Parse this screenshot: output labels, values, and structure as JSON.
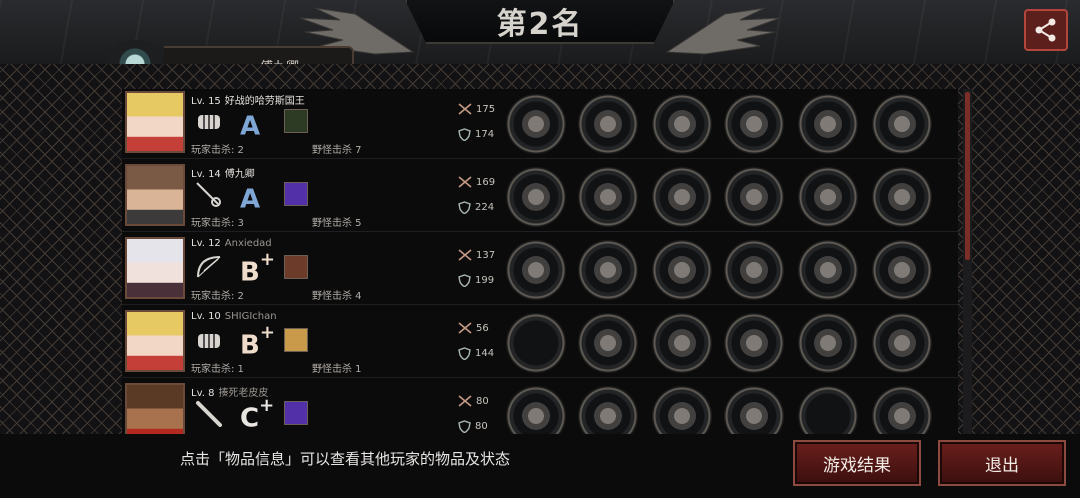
{
  "header": {
    "title": "第2名",
    "player_tab_label": "傅九卿"
  },
  "players": [
    {
      "level": "Lv. 15",
      "name": "好战的哈劳斯国王",
      "name_dim": false,
      "weapon": "fist",
      "rank": "A",
      "rank_sup": "",
      "rank_class": "a",
      "kills": "玩家击杀: 2",
      "monster_kills": "野怪击杀 7",
      "attack": "175",
      "defense": "174",
      "items": [
        "gauntlet",
        "helmet",
        "chainmail",
        "shield",
        "boots",
        "scope"
      ]
    },
    {
      "level": "Lv. 14",
      "name": "傅九卿",
      "name_dim": false,
      "weapon": "rapier",
      "rank": "A",
      "rank_sup": "",
      "rank_class": "a",
      "kills": "玩家击杀: 3",
      "monster_kills": "野怪击杀 5",
      "attack": "169",
      "defense": "224",
      "items": [
        "spear",
        "helmet-dark",
        "armor-dark",
        "gloves-white",
        "scroll",
        "galaxy"
      ]
    },
    {
      "level": "Lv. 12",
      "name": "Anxiedad",
      "name_dim": true,
      "weapon": "bow",
      "rank": "B",
      "rank_sup": "+",
      "rank_class": "b",
      "kills": "玩家击杀: 2",
      "monster_kills": "野怪击杀 4",
      "attack": "137",
      "defense": "199",
      "items": [
        "bow-pink",
        "helmet-gold",
        "armor-red",
        "necklace",
        "boots-purple",
        "bracer"
      ]
    },
    {
      "level": "Lv. 10",
      "name": "SHIGIchan",
      "name_dim": true,
      "weapon": "fist",
      "rank": "B",
      "rank_sup": "+",
      "rank_class": "b",
      "kills": "玩家击杀: 1",
      "monster_kills": "野怪击杀 1",
      "attack": "56",
      "defense": "144",
      "items": [
        "empty",
        "laurel",
        "jacket",
        "spiked",
        "sneakers",
        "scope"
      ]
    },
    {
      "level": "Lv. 8",
      "name": "揍死老皮皮",
      "name_dim": true,
      "weapon": "bat",
      "rank": "C",
      "rank_sup": "+",
      "rank_class": "c",
      "kills": "",
      "monster_kills": "",
      "attack": "80",
      "defense": "80",
      "items": [
        "fire-wand",
        "crown",
        "cloth",
        "necklace",
        "empty",
        "flag"
      ]
    }
  ],
  "footer": {
    "hint": "点击「物品信息」可以查看其他玩家的物品及状态",
    "result_button": "游戏结果",
    "exit_button": "退出"
  },
  "colors": {
    "accent_red": "#6a1f1c",
    "rank_a": "#7ea7d6",
    "scroll_thumb": "#7a2e27"
  },
  "icons": {
    "attack": "crossed-swords-icon",
    "defense": "shield-icon",
    "share": "share-icon"
  }
}
